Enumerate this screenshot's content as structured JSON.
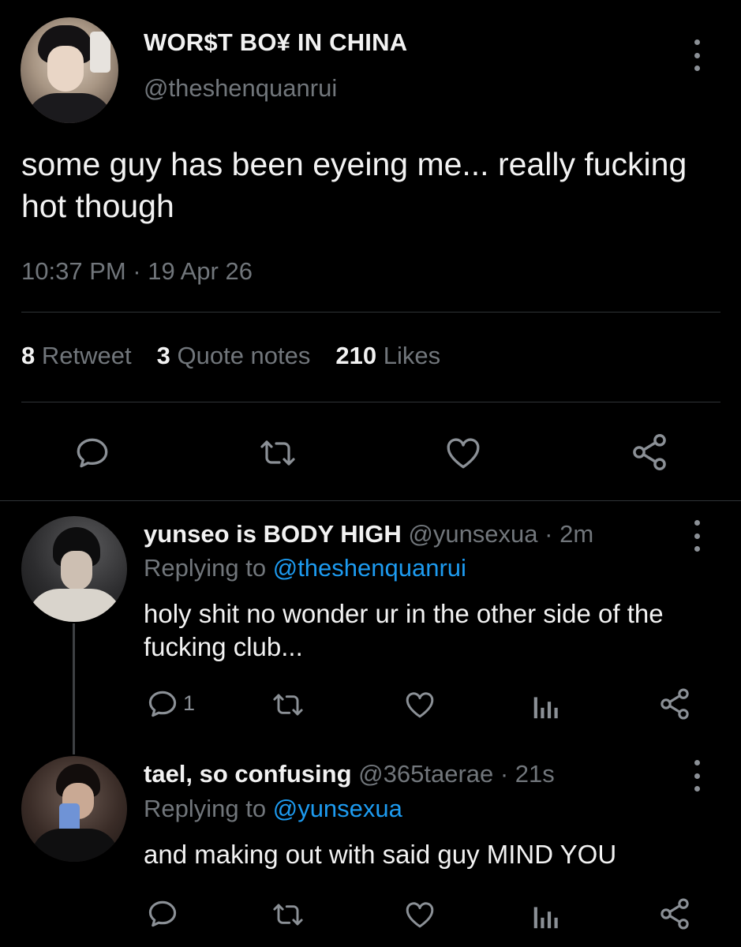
{
  "main_tweet": {
    "display_name": "WOR$T BO¥ IN CHINA",
    "handle": "@theshenquanrui",
    "text": "some guy has been eyeing me... really fucking hot though",
    "timestamp": "10:37 PM · 19 Apr 26",
    "stats": {
      "retweets_count": "8",
      "retweets_label": "Retweet",
      "quotes_count": "3",
      "quotes_label": "Quote notes",
      "likes_count": "210",
      "likes_label": "Likes"
    },
    "icons": [
      "reply-icon",
      "retweet-icon",
      "like-icon",
      "share-icon",
      "more-icon"
    ]
  },
  "replies": [
    {
      "display_name": "yunseo is BODY HIGH",
      "meta": "@yunsexua · 2m",
      "replying_prefix": "Replying to ",
      "replying_to": "@theshenquanrui",
      "text": "holy shit no wonder ur in the other side of the fucking club...",
      "reply_count": "1"
    },
    {
      "display_name": "tael, so confusing",
      "meta": "@365taerae · 21s",
      "replying_prefix": "Replying to ",
      "replying_to": "@yunsexua",
      "text": "and making out with said guy MIND YOU",
      "reply_count": ""
    }
  ],
  "colors": {
    "background": "#000000",
    "text_primary": "#f2f2f2",
    "text_secondary": "#71767b",
    "link": "#1d9bf0",
    "divider": "#2f3336"
  }
}
